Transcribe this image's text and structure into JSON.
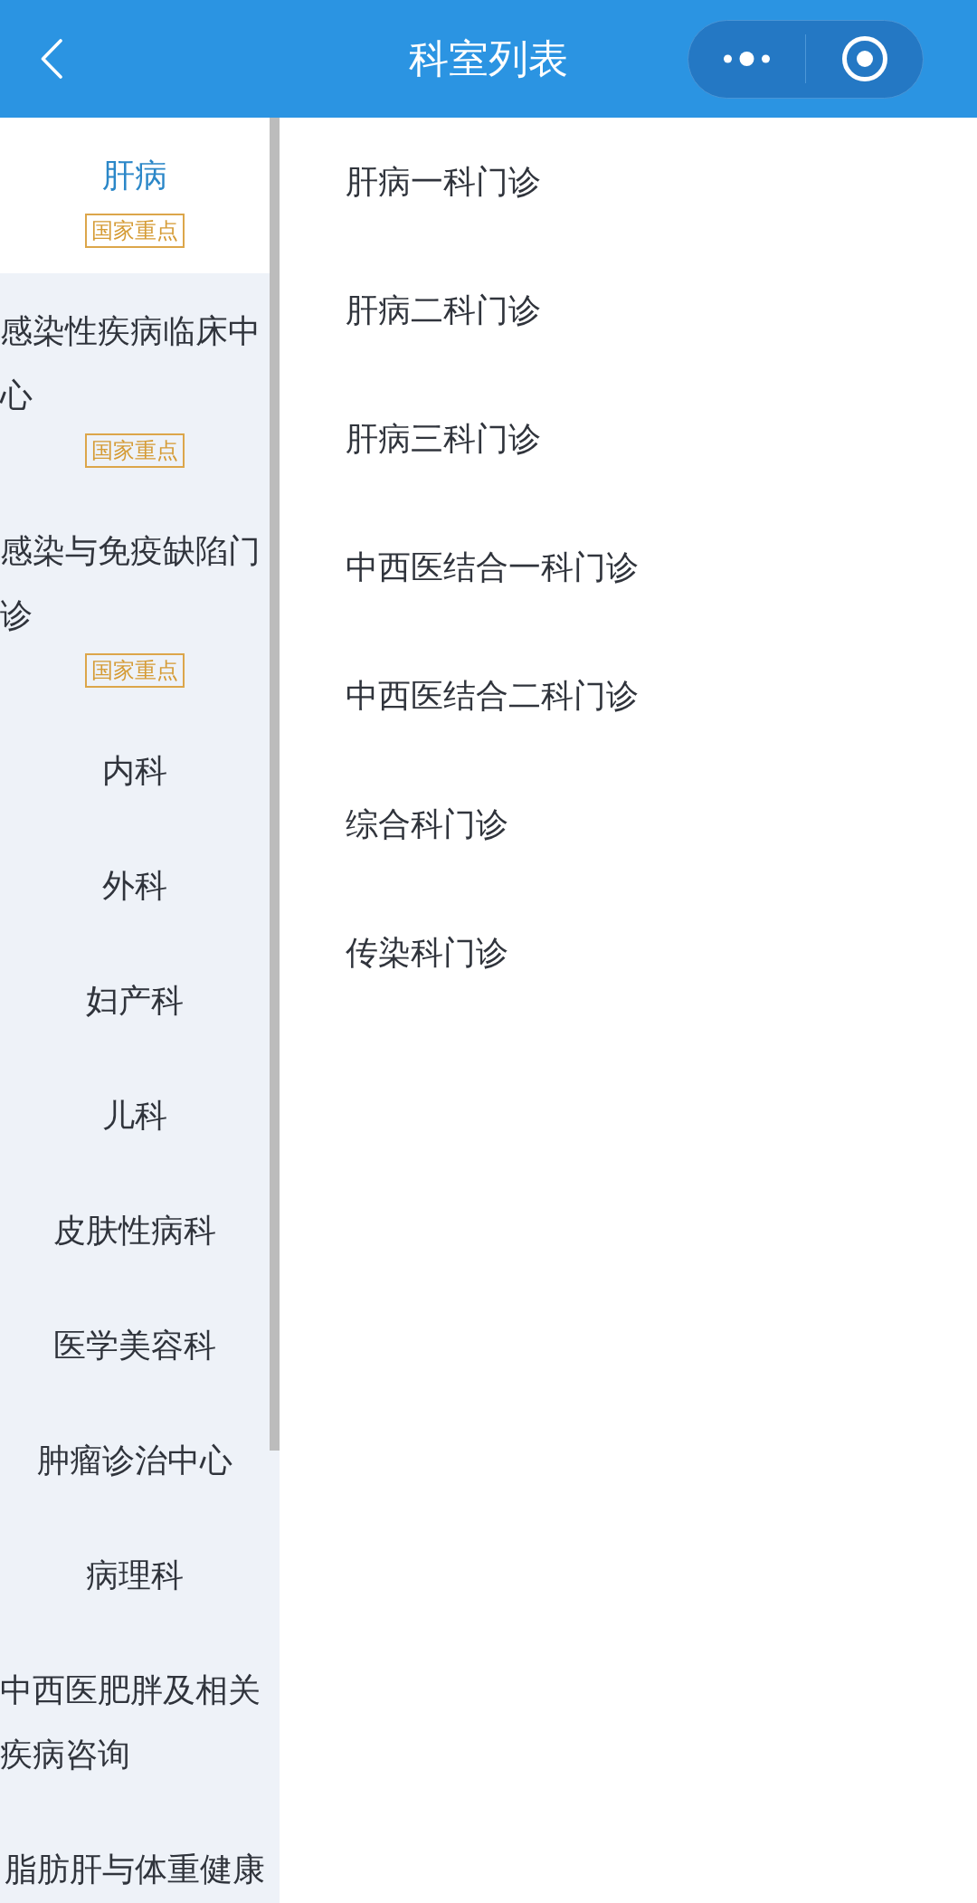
{
  "nav_bar": {
    "title": "科室列表"
  },
  "departments": [
    {
      "name": "肝病",
      "selected": true,
      "badge": "国家重点"
    },
    {
      "name": "感染性疾病临床中心",
      "selected": false,
      "badge": "国家重点"
    },
    {
      "name": "感染与免疫缺陷门诊",
      "selected": false,
      "badge": "国家重点"
    },
    {
      "name": "内科",
      "selected": false
    },
    {
      "name": "外科",
      "selected": false
    },
    {
      "name": "妇产科",
      "selected": false
    },
    {
      "name": "儿科",
      "selected": false
    },
    {
      "name": "皮肤性病科",
      "selected": false
    },
    {
      "name": "医学美容科",
      "selected": false
    },
    {
      "name": "肿瘤诊治中心",
      "selected": false
    },
    {
      "name": "病理科",
      "selected": false
    },
    {
      "name": "中西医肥胖及相关疾病咨询",
      "selected": false
    },
    {
      "name": "脂肪肝与体重健康",
      "selected": false
    }
  ],
  "clinics": [
    {
      "name": "肝病一科门诊"
    },
    {
      "name": "肝病二科门诊"
    },
    {
      "name": "肝病三科门诊"
    },
    {
      "name": "中西医结合一科门诊"
    },
    {
      "name": "中西医结合二科门诊"
    },
    {
      "name": "综合科门诊"
    },
    {
      "name": "传染科门诊"
    }
  ]
}
